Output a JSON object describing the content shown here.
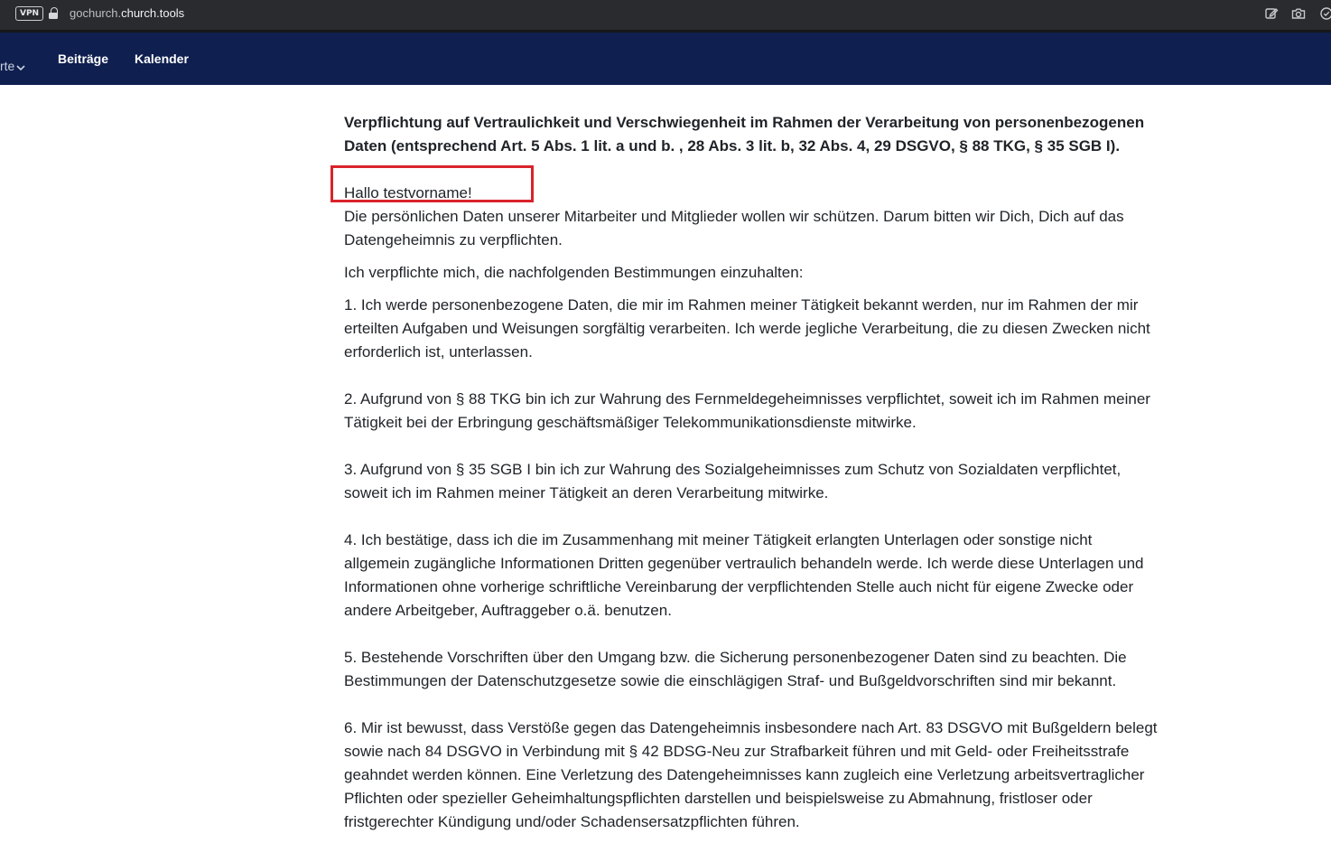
{
  "browser": {
    "vpn_label": "VPN",
    "url_prefix": "gochurch.",
    "url_host": "church.tools",
    "icons": [
      "edit-icon",
      "camera-icon",
      "shield-check-icon"
    ]
  },
  "navbar": {
    "partial_item": "rte",
    "items": [
      {
        "label": "Beiträge"
      },
      {
        "label": "Kalender"
      }
    ]
  },
  "document": {
    "heading": "Verpflichtung auf Vertraulichkeit und Verschwiegenheit im Rahmen der Verarbeitung von personenbezogenen Daten (entsprechend Art. 5 Abs. 1 lit. a und b. , 28 Abs. 3 lit. b, 32 Abs. 4, 29 DSGVO, § 88 TKG, § 35 SGB I).",
    "greeting": "Hallo testvorname!",
    "intro": "Die persönlichen Daten unserer Mitarbeiter und Mitglieder wollen wir schützen. Darum bitten wir Dich, Dich auf das Datengeheimnis zu verpflichten.",
    "pledge": "Ich verpflichte mich, die nachfolgenden Bestimmungen einzuhalten:",
    "items": [
      "1. Ich werde personenbezogene Daten, die mir im Rahmen meiner Tätigkeit bekannt werden, nur im Rahmen der mir erteilten Aufgaben und Weisungen sorgfältig verarbeiten. Ich werde jegliche Verarbeitung, die zu diesen Zwecken nicht erforderlich ist, unterlassen.",
      "2. Aufgrund von § 88 TKG bin ich zur Wahrung des Fernmeldegeheimnisses verpflichtet, soweit ich im Rahmen meiner Tätigkeit bei der Erbringung geschäftsmäßiger Telekommunikationsdienste mitwirke.",
      "3. Aufgrund von § 35 SGB I bin ich zur Wahrung des Sozialgeheimnisses zum Schutz von Sozialdaten verpflichtet, soweit ich im Rahmen meiner Tätigkeit an deren Verarbeitung mitwirke.",
      "4. Ich bestätige, dass ich die im Zusammenhang mit meiner Tätigkeit erlangten Unterlagen oder sonstige nicht allgemein zugängliche Informationen Dritten gegenüber vertraulich behandeln werde. Ich werde diese Unterlagen und Informationen ohne vorherige schriftliche Vereinbarung der verpflichtenden Stelle auch nicht für eigene Zwecke oder andere Arbeitgeber, Auftraggeber o.ä. benutzen.",
      "5. Bestehende Vorschriften über den Umgang bzw. die Sicherung personenbezogener Daten sind zu beachten. Die Bestimmungen der Datenschutzgesetze sowie die einschlägigen Straf- und Bußgeldvorschriften sind mir bekannt.",
      "6. Mir ist bewusst, dass Verstöße gegen das Datengeheimnis insbesondere nach Art. 83 DSGVO mit Bußgeldern belegt sowie nach 84 DSGVO in Verbindung mit § 42 BDSG-Neu zur Strafbarkeit führen und mit Geld- oder Freiheitsstrafe geahndet werden können. Eine Verletzung des Datengeheimnisses kann zugleich eine Verletzung arbeitsvertraglicher Pflichten oder spezieller Geheimhaltungspflichten darstellen und beispielsweise zu Abmahnung, fristloser oder fristgerechter Kündigung und/oder Schadensersatzpflichten führen."
    ]
  },
  "colors": {
    "navbar_bg": "#0f1f4f",
    "highlight_border": "#d9232b"
  }
}
